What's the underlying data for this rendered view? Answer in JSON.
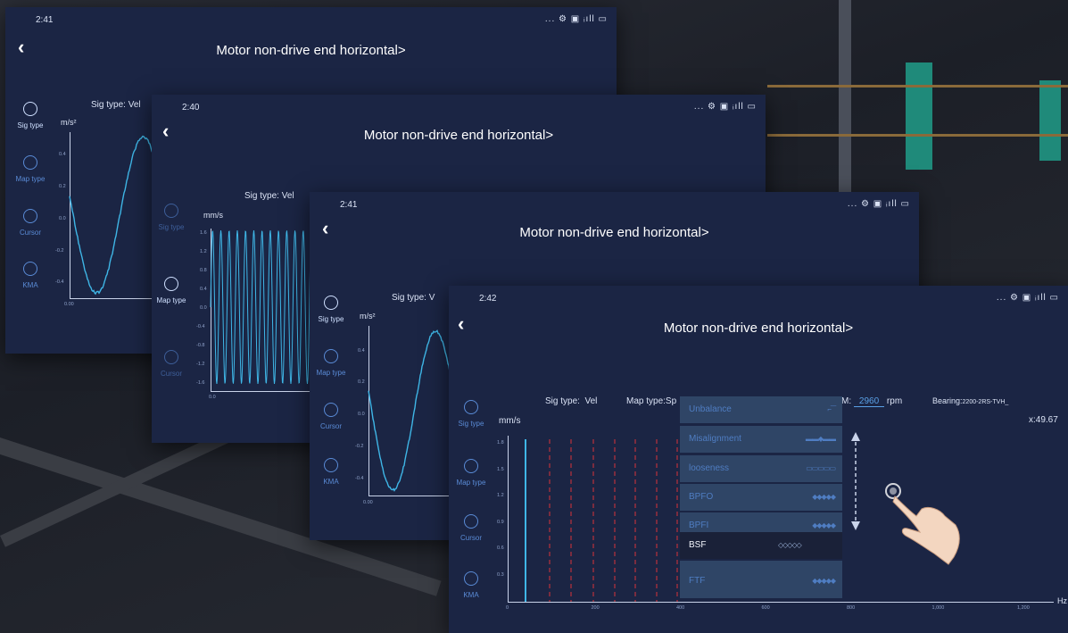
{
  "screens": [
    {
      "time": "2:41",
      "status_icons": "... ⚙ ▣ ᵢıll ▭",
      "title": "Motor non-drive end horizontal",
      "title_arrow": ">",
      "sig_type_label": "Sig type:",
      "sig_type_value": "Vel",
      "unit": "m/s²",
      "sidebar": [
        "Sig type",
        "Map type",
        "Cursor",
        "KMA"
      ],
      "y_ticks": [
        "0.4",
        "0.2",
        "0.0",
        "-0.2",
        "-0.4"
      ],
      "x_tick": "0.00"
    },
    {
      "time": "2:40",
      "status_icons": "... ⚙ ▣ ᵢıll ▭",
      "title": "Motor non-drive end horizontal",
      "title_arrow": ">",
      "sig_type_label": "Sig type:",
      "sig_type_value": "Vel",
      "unit": "mm/s",
      "sidebar": [
        "Sig type",
        "Map type",
        "Cursor"
      ],
      "y_ticks": [
        "1.6",
        "1.2",
        "0.8",
        "0.4",
        "0.0",
        "-0.4",
        "-0.8",
        "-1.2",
        "-1.6"
      ],
      "x_tick": "0.0"
    },
    {
      "time": "2:41",
      "status_icons": "... ⚙ ▣ ᵢıll ▭",
      "title": "Motor non-drive end horizontal",
      "title_arrow": ">",
      "sig_type_label": "Sig type:",
      "sig_type_value": "V",
      "unit": "m/s²",
      "sidebar": [
        "Sig type",
        "Map type",
        "Cursor",
        "KMA"
      ],
      "y_ticks": [
        "0.4",
        "0.2",
        "0.0",
        "-0.2",
        "-0.4"
      ],
      "x_tick": "0.00"
    },
    {
      "time": "2:42",
      "status_icons": "... ⚙ ▣ ᵢıll ▭",
      "title": "Motor non-drive end horizontal",
      "title_arrow": ">",
      "sig_type_label": "Sig type:",
      "sig_type_value": "Vel",
      "map_type_label": "Map type:",
      "map_type_value": "Sp",
      "rpm_label": "M:",
      "rpm_value": "2960",
      "rpm_unit": "rpm",
      "bearing_label": "Bearing:",
      "bearing_value": "2200-2RS-TVH_",
      "cursor_x": "x:49.67",
      "unit": "mm/s",
      "x_unit": "Hz",
      "sidebar": [
        "Sig type",
        "Map type",
        "Cursor",
        "KMA"
      ],
      "y_ticks": [
        "1.8",
        "1.5",
        "1.2",
        "0.9",
        "0.6",
        "0.3"
      ],
      "x_ticks": [
        "0",
        "200",
        "400",
        "600",
        "800",
        "1,000",
        "1,200"
      ],
      "menu": [
        {
          "label": "Unbalance",
          "symbol": "⌐‾‾‾"
        },
        {
          "label": "Misalignment",
          "symbol": "▬▬◆▬▬"
        },
        {
          "label": "looseness",
          "symbol": "▭▭▭▭▭"
        },
        {
          "label": "BPFO",
          "symbol": "◆◆◆◆◆"
        },
        {
          "label": "BPFI",
          "symbol": "◆◆◆◆◆"
        },
        {
          "label": "BSF",
          "symbol": "◇◇◇◇◇"
        },
        {
          "label": "FTF",
          "symbol": "◆◆◆◆◆"
        }
      ]
    }
  ],
  "colors": {
    "screen_bg": "#1b2544",
    "signal": "#3fb6e6",
    "marker": "#d8323a",
    "menu_highlight": "#2f4566"
  }
}
